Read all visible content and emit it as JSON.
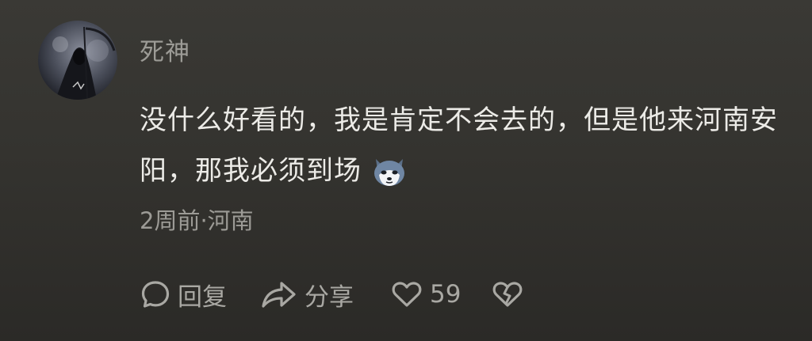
{
  "comment": {
    "username": "死神",
    "content": "没什么好看的，我是肯定不会去的，但是他来河南安阳，那我必须到场",
    "time": "2周前",
    "separator": "·",
    "location": "河南",
    "emoji_icon": "husky-dog-emoji-icon"
  },
  "actions": {
    "reply_label": "回复",
    "share_label": "分享",
    "like_count": "59"
  }
}
